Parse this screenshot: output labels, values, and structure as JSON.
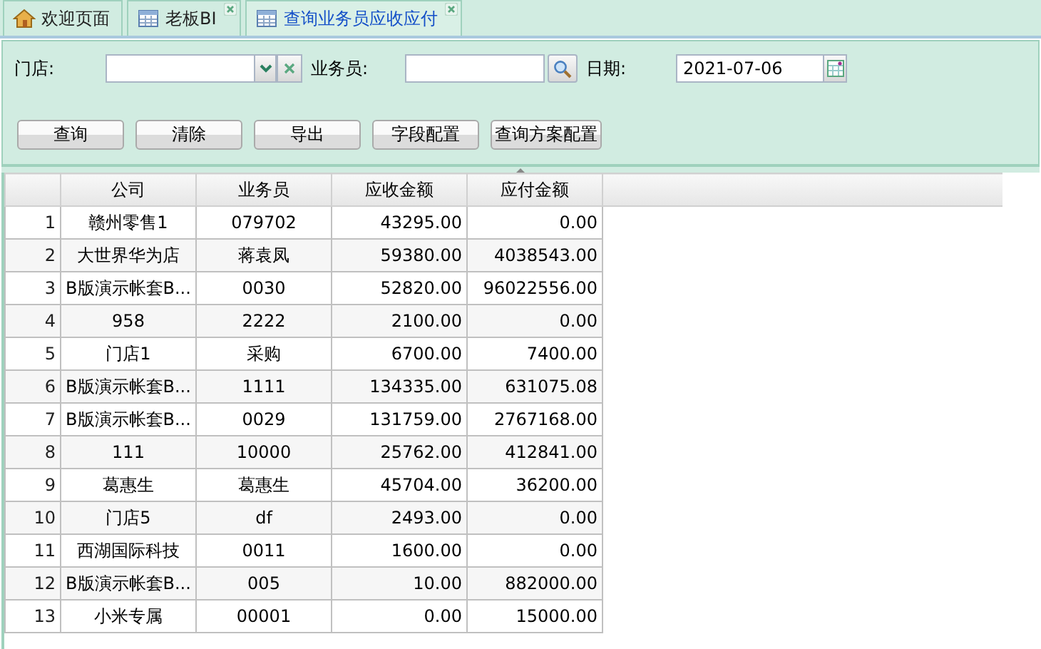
{
  "tabs": [
    {
      "label": "欢迎页面",
      "kind": "home",
      "closable": false,
      "selected": false
    },
    {
      "label": "老板BI",
      "kind": "table",
      "closable": true,
      "selected": false
    },
    {
      "label": "查询业务员应收应付",
      "kind": "table",
      "closable": true,
      "selected": true
    }
  ],
  "filters": {
    "store": {
      "label": "门店:"
    },
    "salesman": {
      "label": "业务员:"
    },
    "date": {
      "label": "日期:",
      "value": "2021-07-06"
    }
  },
  "buttons": [
    "查询",
    "清除",
    "导出",
    "字段配置",
    "查询方案配置"
  ],
  "table": {
    "columns": [
      "",
      "公司",
      "业务员",
      "应收金额",
      "应付金额"
    ],
    "rows": [
      [
        "1",
        "赣州零售1",
        "079702",
        "43295.00",
        "0.00"
      ],
      [
        "2",
        "大世界华为店",
        "蒋袁凤",
        "59380.00",
        "4038543.00"
      ],
      [
        "3",
        "B版演示帐套B...",
        "0030",
        "52820.00",
        "96022556.00"
      ],
      [
        "4",
        "958",
        "2222",
        "2100.00",
        "0.00"
      ],
      [
        "5",
        "门店1",
        "采购",
        "6700.00",
        "7400.00"
      ],
      [
        "6",
        "B版演示帐套B...",
        "1111",
        "134335.00",
        "631075.08"
      ],
      [
        "7",
        "B版演示帐套B...",
        "0029",
        "131759.00",
        "2767168.00"
      ],
      [
        "8",
        "111",
        "10000",
        "25762.00",
        "412841.00"
      ],
      [
        "9",
        "葛惠生",
        "葛惠生",
        "45704.00",
        "36200.00"
      ],
      [
        "10",
        "门店5",
        "df",
        "2493.00",
        "0.00"
      ],
      [
        "11",
        "西湖国际科技",
        "0011",
        "1600.00",
        "0.00"
      ],
      [
        "12",
        "B版演示帐套B...",
        "005",
        "10.00",
        "882000.00"
      ],
      [
        "13",
        "小米专属",
        "00001",
        "0.00",
        "15000.00"
      ]
    ]
  }
}
